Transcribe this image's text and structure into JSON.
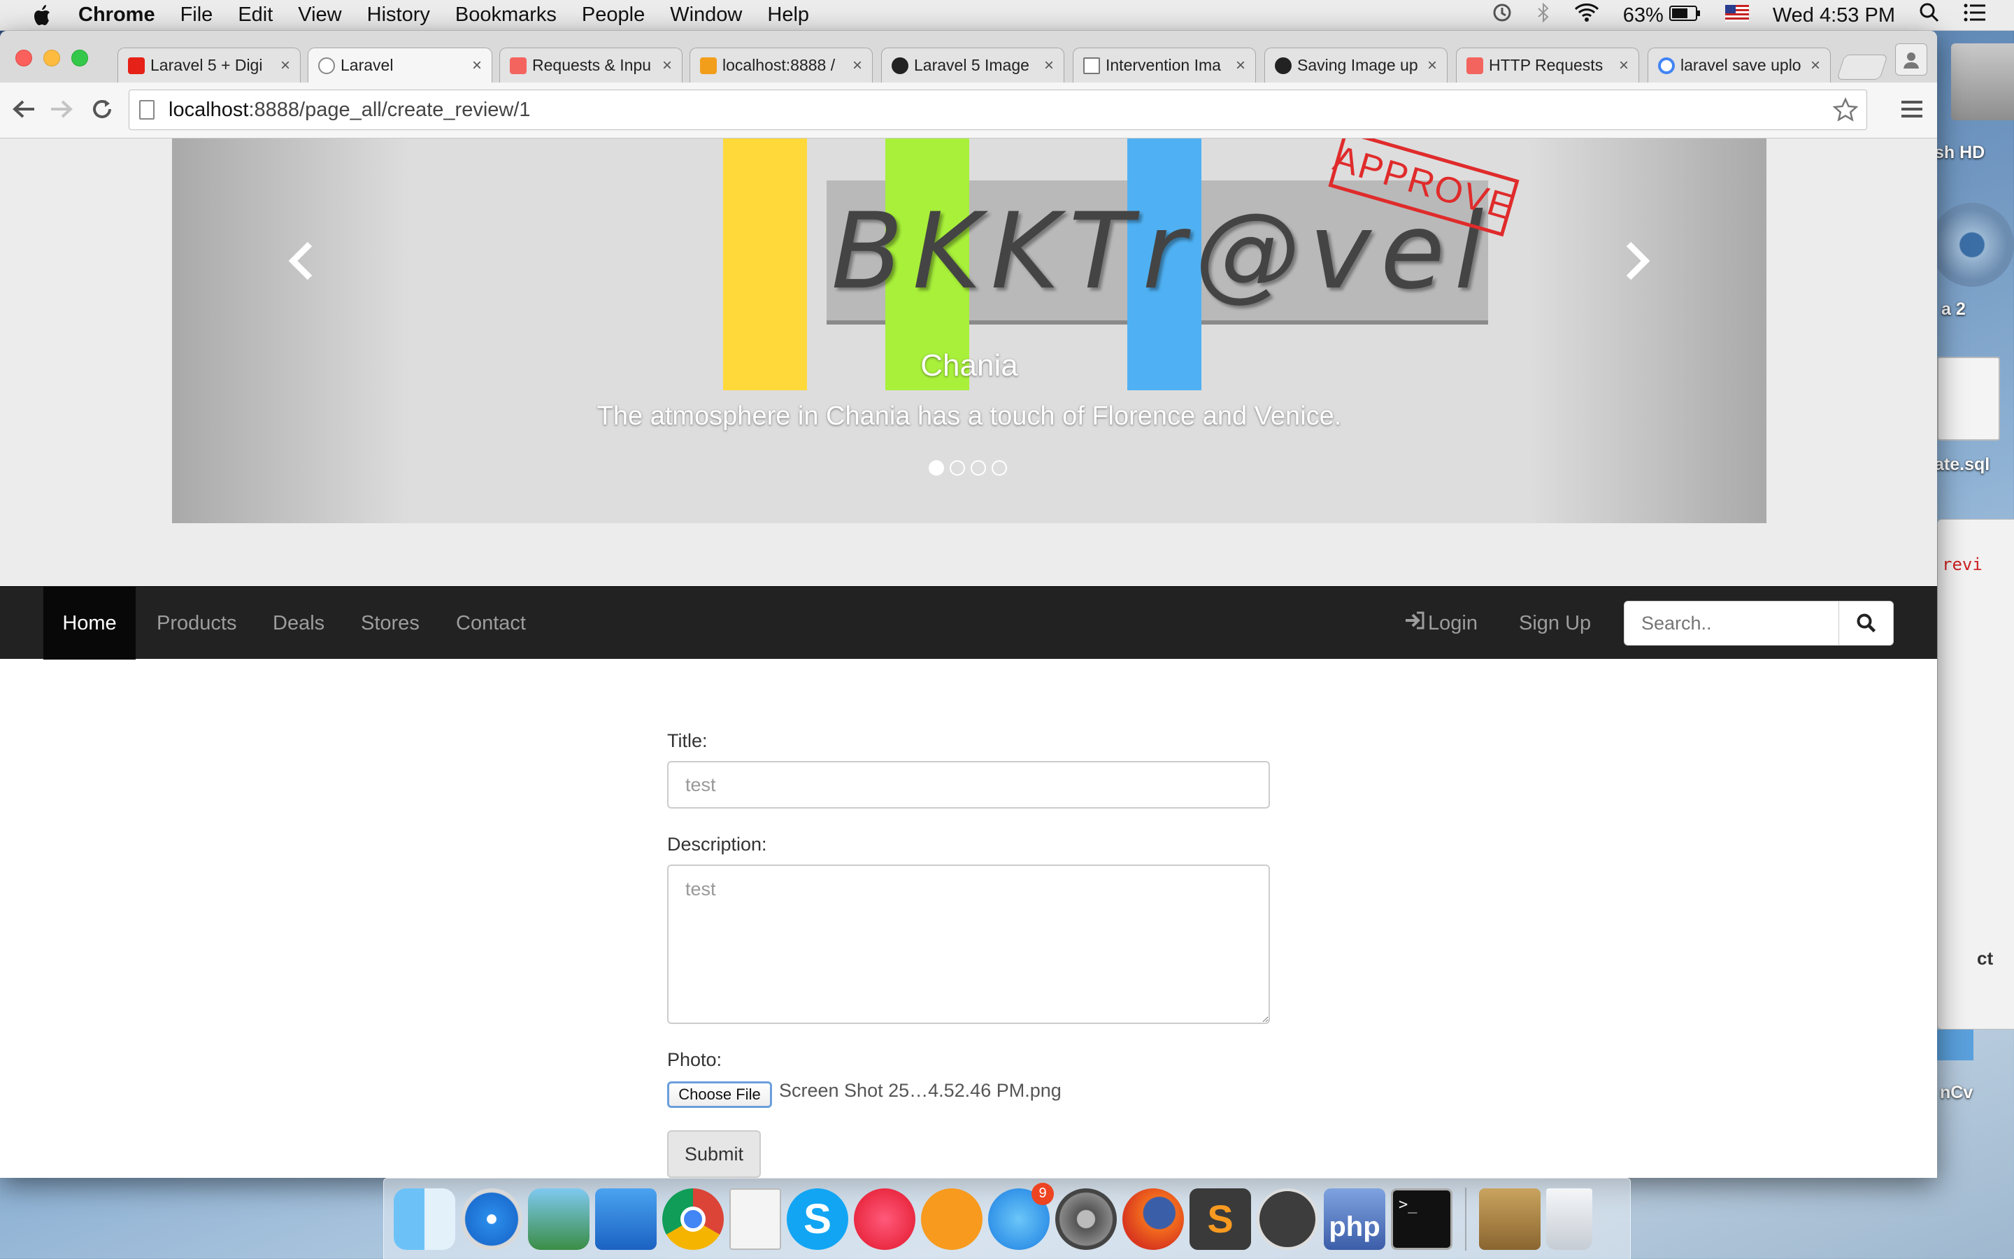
{
  "menubar": {
    "app_name": "Chrome",
    "items": [
      "File",
      "Edit",
      "View",
      "History",
      "Bookmarks",
      "People",
      "Window",
      "Help"
    ],
    "battery": "63%",
    "clock": "Wed 4:53 PM"
  },
  "desktop": {
    "labels": [
      "sh HD",
      "a 2",
      "ate.sql",
      "revi",
      "ct",
      "nCv"
    ]
  },
  "tabs": [
    {
      "title": "Laravel 5 + Digi",
      "favicon_color": "#e62117"
    },
    {
      "title": "Laravel",
      "favicon_color": "#888888"
    },
    {
      "title": "Requests & Inpu",
      "favicon_color": "#f4645f"
    },
    {
      "title": "localhost:8888 /",
      "favicon_color": "#f29e1b"
    },
    {
      "title": "Laravel 5 Image",
      "favicon_color": "#222222"
    },
    {
      "title": "Intervention Ima",
      "favicon_color": "#ffffff"
    },
    {
      "title": "Saving Image up",
      "favicon_color": "#222222"
    },
    {
      "title": "HTTP Requests",
      "favicon_color": "#f4645f"
    },
    {
      "title": "laravel save uplo",
      "favicon_color": "#4285f4"
    }
  ],
  "address": {
    "host": "localhost",
    "path": ":8888/page_all/create_review/1"
  },
  "carousel": {
    "logo_letters": [
      "B",
      "K",
      "K",
      "T",
      "r",
      "@",
      "v",
      "e",
      "l"
    ],
    "stamp": "APPROVE",
    "caption_title": "Chania",
    "caption_text": "The atmosphere in Chania has a touch of Florence and Venice.",
    "indicator_count": 4,
    "active_indicator": 0
  },
  "navbar": {
    "items": [
      "Home",
      "Products",
      "Deals",
      "Stores",
      "Contact"
    ],
    "login": "Login",
    "signup": "Sign Up",
    "search_placeholder": "Search.."
  },
  "form": {
    "title_label": "Title:",
    "title_value": "test",
    "description_label": "Description:",
    "description_value": "test",
    "photo_label": "Photo:",
    "file_button": "Choose File",
    "file_name": "Screen Shot 25…4.52.46 PM.png",
    "submit": "Submit"
  },
  "dock": {
    "apps": [
      "finder-icon",
      "safari-icon",
      "iphoto-icon",
      "keynote-icon",
      "chrome-icon",
      "textedit-icon",
      "skype-icon",
      "itunes-icon",
      "ibooks-icon",
      "app-store-icon",
      "system-preferences-icon",
      "firefox-icon",
      "sublime-text-icon",
      "sequel-pro-icon",
      "php-icon",
      "terminal-icon",
      "archive-icon",
      "trash-icon"
    ],
    "app_store_badge": "9"
  }
}
